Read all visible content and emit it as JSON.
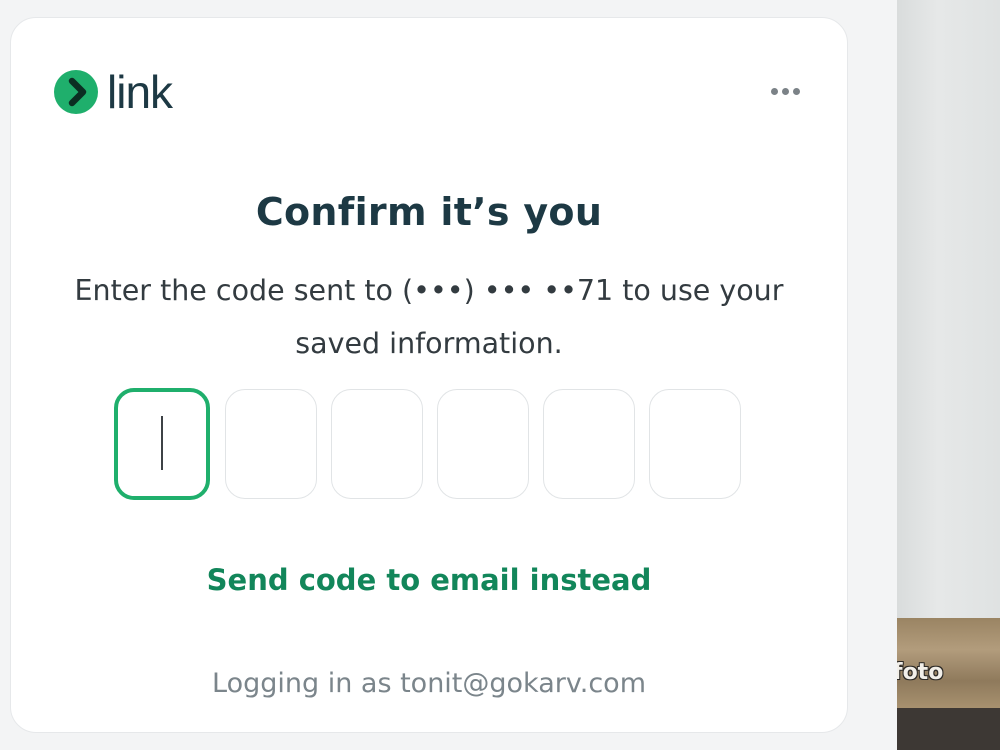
{
  "brand": {
    "name": "link",
    "logo_icon": "chevron-right-icon",
    "logo_color": "#1faf6c"
  },
  "menu": {
    "icon": "more-horizontal-icon"
  },
  "title": "Confirm it’s you",
  "subtitle": {
    "line1": "Enter the code sent to (•••) ••• ••71 to use your",
    "line2": "saved information."
  },
  "code": {
    "digits": [
      "",
      "",
      "",
      "",
      "",
      ""
    ],
    "active_index": 0,
    "active_border_color": "#1faf6c"
  },
  "send_email_link": "Send code to email instead",
  "footer": "Logging in as tonit@gokarv.com",
  "background_photo": {
    "caption_fragment": "foto"
  },
  "colors": {
    "heading": "#1d3944",
    "link": "#12865a",
    "muted": "#7b858b"
  }
}
